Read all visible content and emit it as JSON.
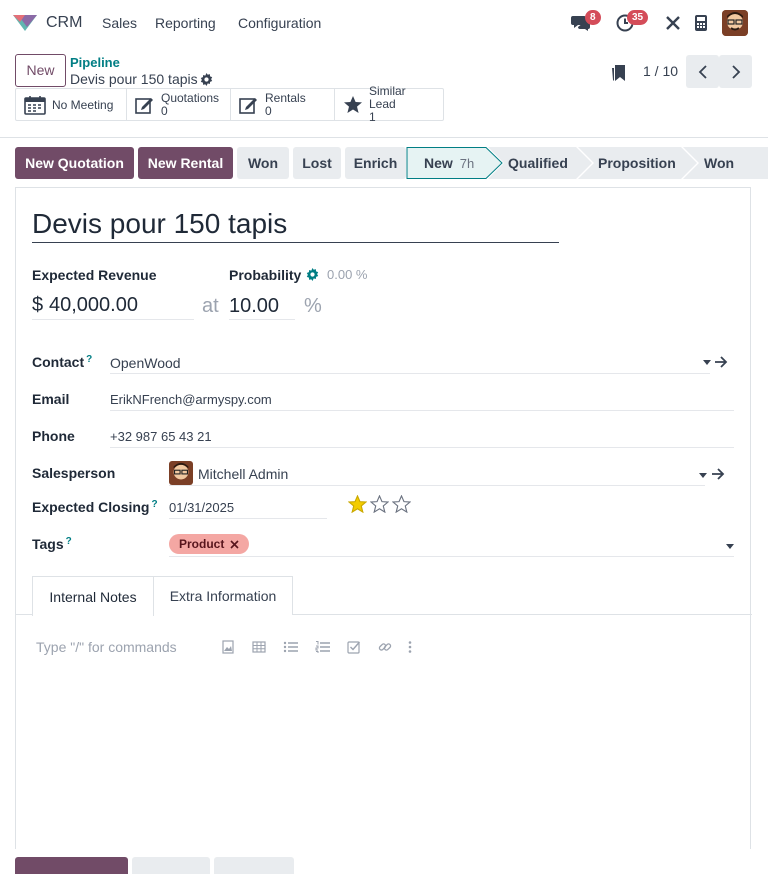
{
  "app": {
    "name": "CRM",
    "menu": [
      "Sales",
      "Reporting",
      "Configuration"
    ],
    "messages_count": "8",
    "activities_count": "35"
  },
  "header": {
    "new_label": "New",
    "breadcrumb_parent": "Pipeline",
    "breadcrumb_current": "Devis pour 150 tapis",
    "pager": "1 / 10"
  },
  "smart_buttons": [
    {
      "icon": "calendar-icon",
      "label": "No Meeting",
      "count": ""
    },
    {
      "icon": "edit-icon",
      "label": "Quotations",
      "count": "0"
    },
    {
      "icon": "edit-icon",
      "label": "Rentals",
      "count": "0"
    },
    {
      "icon": "star-icon",
      "label": "Similar Lead",
      "count": "1"
    }
  ],
  "actions": {
    "new_quotation": "New Quotation",
    "new_rental": "New Rental",
    "won": "Won",
    "lost": "Lost",
    "enrich": "Enrich"
  },
  "stages": {
    "active": "New",
    "active_duration": "7h",
    "items": [
      "Qualified",
      "Proposition",
      "Won"
    ]
  },
  "form": {
    "title": "Devis pour 150 tapis",
    "expected_revenue_label": "Expected Revenue",
    "currency": "$",
    "expected_revenue": "40,000.00",
    "at": "at",
    "probability_label": "Probability",
    "auto_probability": "0.00 %",
    "probability": "10.00",
    "percent": "%",
    "contact_label": "Contact",
    "contact": "OpenWood",
    "email_label": "Email",
    "email": "ErikNFrench@armyspy.com",
    "phone_label": "Phone",
    "phone": "+32 987 65 43 21",
    "salesperson_label": "Salesperson",
    "salesperson": "Mitchell Admin",
    "expected_closing_label": "Expected Closing",
    "expected_closing": "01/31/2025",
    "priority_stars": 1,
    "priority_max": 3,
    "tags_label": "Tags",
    "tags": [
      "Product"
    ],
    "help_mark": "?"
  },
  "notebook": {
    "tabs": [
      "Internal Notes",
      "Extra Information"
    ],
    "active_tab": "Internal Notes",
    "placeholder": "Type \"/\" for commands"
  },
  "colors": {
    "primary": "#714b67",
    "teal": "#017e84",
    "star": "#f3cc00",
    "tag": "#f4a7a3"
  }
}
